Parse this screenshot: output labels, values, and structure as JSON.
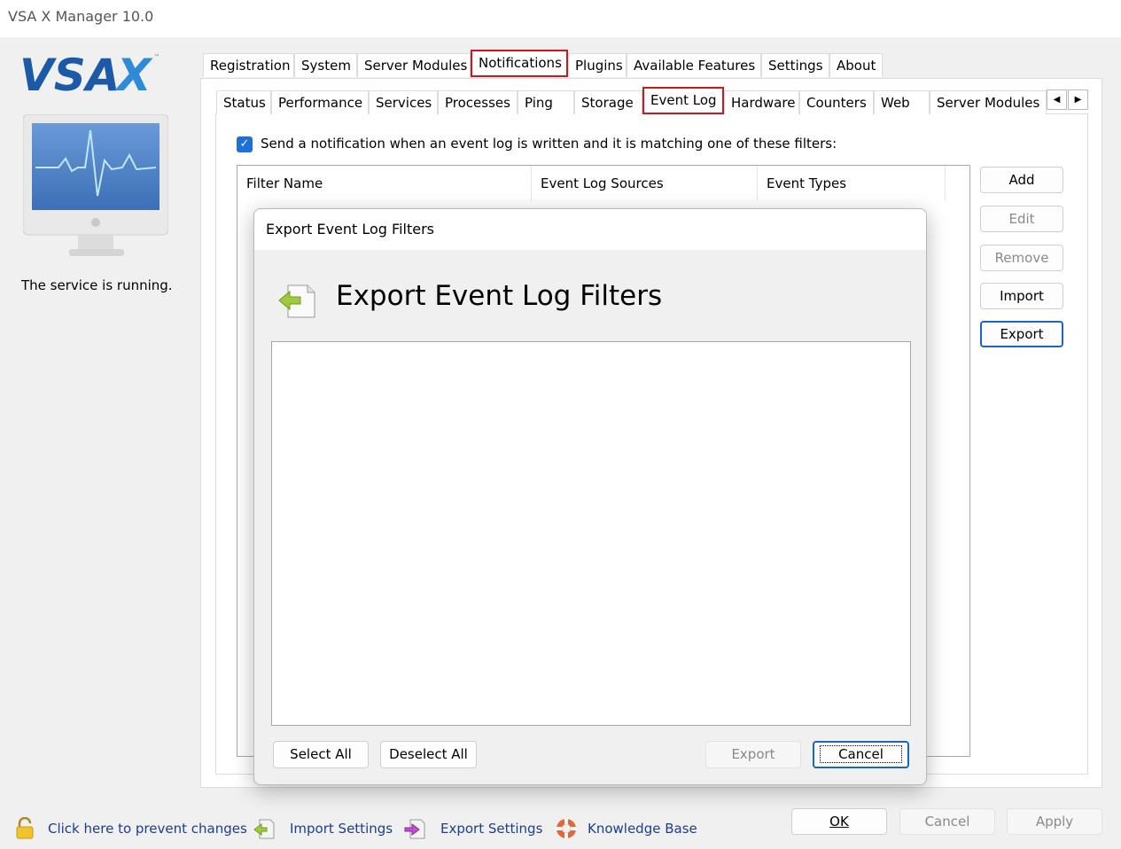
{
  "window": {
    "title": "VSA X Manager 10.0"
  },
  "brand": {
    "logo_text": "VSAX",
    "accent": "#1c5aa8",
    "highlight": "#d4141c"
  },
  "sidebar": {
    "status_text": "The service is running.",
    "monitor_icon": "monitor-heartbeat-icon"
  },
  "tabs_top": [
    "Registration",
    "System",
    "Server Modules",
    "Notifications",
    "Plugins",
    "Available Features",
    "Settings",
    "About"
  ],
  "tabs_top_selected": "Notifications",
  "tabs_sub": [
    "Status",
    "Performance",
    "Services",
    "Processes",
    "Ping",
    "Storage",
    "Event Log",
    "Hardware",
    "Counters",
    "Web",
    "Server Modules"
  ],
  "tabs_sub_selected": "Event Log",
  "eventlog": {
    "checkbox_checked": true,
    "checkbox_label": "Send a notification when an event log is written and it is matching one of these filters:",
    "columns": [
      "Filter Name",
      "Event Log Sources",
      "Event Types"
    ],
    "buttons": {
      "add": "Add",
      "edit": "Edit",
      "remove": "Remove",
      "import": "Import",
      "export": "Export"
    }
  },
  "dialog": {
    "title": "Export Event Log Filters",
    "heading": "Export Event Log Filters",
    "select_all": "Select All",
    "deselect_all": "Deselect All",
    "export": "Export",
    "cancel": "Cancel"
  },
  "footer": {
    "lock": "Click here to prevent changes",
    "import_settings": "Import Settings",
    "export_settings": "Export Settings",
    "knowledge_base": "Knowledge Base",
    "ok": "OK",
    "cancel": "Cancel",
    "apply": "Apply"
  }
}
